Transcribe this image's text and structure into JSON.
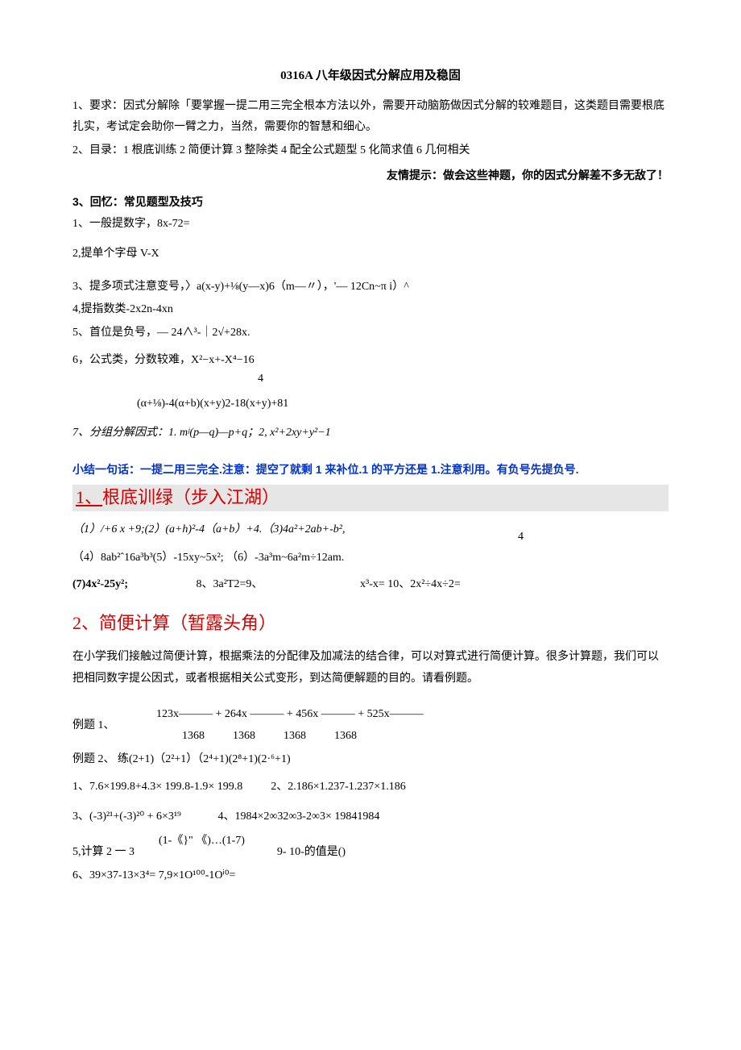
{
  "title": "0316A 八年级因式分解应用及稳固",
  "intro1": "1、要求：因式分解除「要掌握一提二用三完全根本方法以外，需要开动脑筋做因式分解的较难题目，这类题目需要根底扎实，考试定会助你一臂之力，当然，需要你的智慧和细心。",
  "intro2": "2、目录：1 根底训练 2 简便计算 3 整除类 4 配全公式题型 5 化简求值 6 几何相关",
  "tip": "友情提示：做会这些神题，你的因式分解差不多无敌了！",
  "recall_header": "3、回忆：常见题型及技巧",
  "r1": "1、一般提数字，8x-72=",
  "r2": "2,提单个字母 V-X",
  "r3": "3、提多项式注意变号，〉a(x-y)+⅛(y—x)6（m—〃），'— 12Cn~π i）^",
  "r4": "4,提指数类-2x2n-4xn",
  "r5": "5、首位是负号，― 24∧³-｜2√+28x.",
  "r6a": "6，公式类，分数较难，X²−x+-X⁴−16",
  "r6b": "4",
  "r6c": "(α+⅛)-4(α+b)(x+y)2-18(x+y)+81",
  "r7": "7、分组分解因式：1. mʲ(p—q)—p+q；2, x²+2xy+y²−1",
  "summary": "小结一句话：一提二用三完全.注意：提空了就剩 1 来补位.1 的平方还是 1.注意利用。有负号先提负号.",
  "sec1_num": "1、",
  "sec1_txt": "根底训绿（步入江湖）",
  "s1_l1": "（1）/+6 x +9;(2）(a+h)²-4（a+b）+4.（3)4a²+2ab+-b²,",
  "s1_l1_r": "4",
  "s1_l2": "（4）8ab²ˆ16a³b³(5）-15xy~5x²; （6）-3a³m~6a²m÷12am.",
  "s1_l3_1": "(7)4x²-25y²;",
  "s1_l3_2": "8、3a²T2=9、",
  "s1_l3_3": "x³-x=    10、2x²÷4x÷2=",
  "sec2": "2、简便计算（暂露头角）",
  "s2_p": "在小学我们接触过简便计算，根据乘法的分配律及加减法的结合律，可以对算式进行简便计算。很多计算题，我们可以把相同数字提公因式，或者根据相关公式变形，到达简便解题的目的。请看例题。",
  "ex1_pre": "例题 1、",
  "ex1_top": "123x——— + 264x ——— + 456x ———  + 525x———",
  "ex1_bot": "1368          1368          1368          1368",
  "ex2": "例题 2、 练(2+1)（2²+1）（2⁴+1)(2⁸+1)(2·⁶+1)",
  "ln1": "1、7.6×199.8+4.3× 199.8-1.9× 199.8          2、2.186×1.237-1.237×1.186",
  "ln3": "3、(-3)²¹+(-3)²⁰ + 6×3¹⁹             4、1984×2∞32∞3-2∞3× 19841984",
  "ln5_pre": "5,计算 2 一 3",
  "ln5_top": "(1-《}\" 《)…(1-7)",
  "ln5_end": "9-       10-的值是()",
  "ln6": "6、39×37-13×3⁴= 7,9×1O¹⁰⁰-1Oⁱ⁰="
}
